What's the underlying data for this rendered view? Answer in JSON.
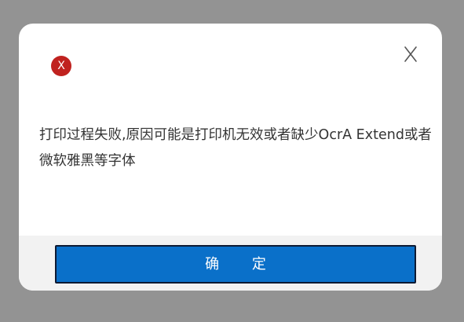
{
  "dialog": {
    "error_icon_glyph": "X",
    "message": "打印过程失败,原因可能是打印机无效或者缺少OcrA Extend或者微软雅黑等字体",
    "confirm_label": "确 定"
  },
  "colors": {
    "overlay": "#939393",
    "error_red": "#c0221f",
    "button_blue": "#0a70c9",
    "footer_gray": "#f2f2f2"
  },
  "icons": {
    "status": "error-icon",
    "close": "close-icon"
  }
}
